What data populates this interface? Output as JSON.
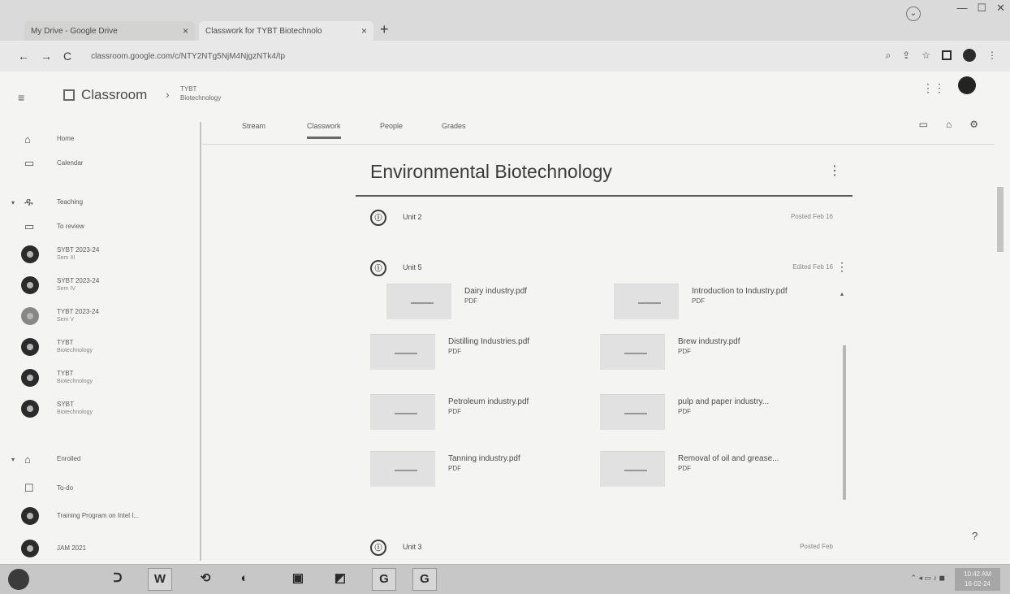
{
  "browser": {
    "tabs": [
      {
        "title": "My Drive - Google Drive",
        "close": "×"
      },
      {
        "title": "Classwork for TYBT Biotechnolo",
        "close": "×"
      }
    ],
    "new_tab": "+",
    "back": "←",
    "forward": "→",
    "reload": "C",
    "url": "classroom.google.com/c/NTY2NTg5NjM4NjgzNTk4/tp",
    "window_controls": [
      "—",
      "☐",
      "✕"
    ]
  },
  "header": {
    "menu": "≡",
    "title": "Classroom",
    "crumb_sep": "›",
    "course_line1": "TYBT",
    "course_line2": "Biotechnology",
    "apps": "⋮⋮"
  },
  "tabs": {
    "items": [
      "Stream",
      "Classwork",
      "People",
      "Grades"
    ],
    "active": "Classwork"
  },
  "sidebar": {
    "items": [
      {
        "label": "Home",
        "sub": ""
      },
      {
        "label": "Calendar",
        "sub": ""
      },
      {
        "label": "Teaching",
        "sub": ""
      },
      {
        "label": "To review",
        "sub": ""
      },
      {
        "label": "SYBT 2023-24",
        "sub": "Sem III"
      },
      {
        "label": "SYBT 2023-24",
        "sub": "Sem IV"
      },
      {
        "label": "TYBT 2023-24",
        "sub": "Sem V"
      },
      {
        "label": "TYBT",
        "sub": "Biotechnology"
      },
      {
        "label": "TYBT",
        "sub": "Biotechnology"
      },
      {
        "label": "SYBT",
        "sub": "Biotechnology"
      },
      {
        "label": "Enrolled",
        "sub": ""
      },
      {
        "label": "To-do",
        "sub": ""
      },
      {
        "label": "Training Program on Intel I...",
        "sub": ""
      },
      {
        "label": "JAM 2021",
        "sub": ""
      }
    ]
  },
  "topic": {
    "title": "Environmental Biotechnology",
    "more": "⋮"
  },
  "materials": [
    {
      "name": "Unit 2",
      "date": "Posted Feb 16",
      "icon": "ⓘ"
    },
    {
      "name": "Unit 5",
      "date": "Edited Feb 16",
      "icon": "ⓘ"
    },
    {
      "name": "Unit 3",
      "date": "Posted Feb",
      "icon": "ⓘ"
    }
  ],
  "attachments": [
    {
      "name": "Dairy industry.pdf",
      "type": "PDF"
    },
    {
      "name": "Introduction to Industry.pdf",
      "type": "PDF"
    },
    {
      "name": "Distilling Industries.pdf",
      "type": "PDF"
    },
    {
      "name": "Brew industry.pdf",
      "type": "PDF"
    },
    {
      "name": "Petroleum industry.pdf",
      "type": "PDF"
    },
    {
      "name": "pulp and paper industry...",
      "type": "PDF"
    },
    {
      "name": "Tanning industry.pdf",
      "type": "PDF"
    },
    {
      "name": "Removal of oil and grease...",
      "type": "PDF"
    }
  ],
  "taskbar": {
    "items": [
      "W",
      "G",
      "G"
    ],
    "clock_time": "10:42 AM",
    "clock_date": "16-02-24"
  }
}
